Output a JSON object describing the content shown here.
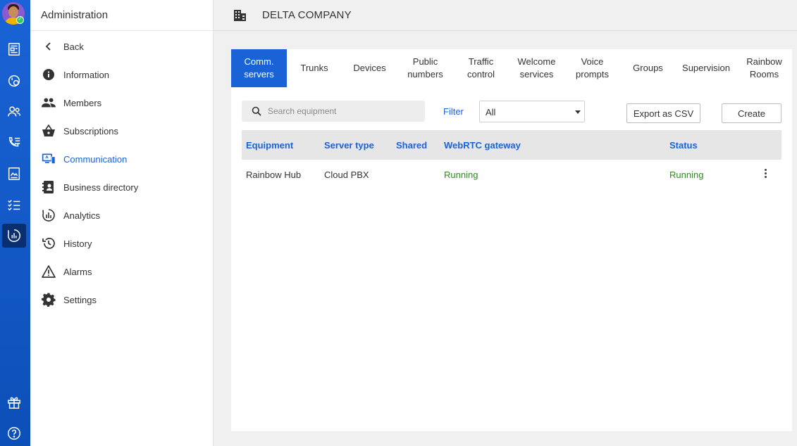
{
  "rail": {
    "items": [
      {
        "icon": "news-icon"
      },
      {
        "icon": "dial-clock-icon"
      },
      {
        "icon": "contacts-icon"
      },
      {
        "icon": "phone-list-icon"
      },
      {
        "icon": "document-icon"
      },
      {
        "icon": "checklist-icon"
      },
      {
        "icon": "dashboard-icon",
        "active": true
      },
      {
        "icon": "gift-icon"
      },
      {
        "icon": "help-icon"
      }
    ]
  },
  "panel": {
    "title": "Administration",
    "items": [
      {
        "label": "Back",
        "icon": "chevron-left-icon"
      },
      {
        "label": "Information",
        "icon": "info-icon"
      },
      {
        "label": "Members",
        "icon": "people-icon"
      },
      {
        "label": "Subscriptions",
        "icon": "basket-icon"
      },
      {
        "label": "Communication",
        "icon": "communication-icon",
        "active": true
      },
      {
        "label": "Business directory",
        "icon": "directory-icon"
      },
      {
        "label": "Analytics",
        "icon": "analytics-icon"
      },
      {
        "label": "History",
        "icon": "history-icon"
      },
      {
        "label": "Alarms",
        "icon": "warning-icon"
      },
      {
        "label": "Settings",
        "icon": "gear-icon"
      }
    ]
  },
  "topbar": {
    "company": "DELTA COMPANY",
    "icon": "building-icon"
  },
  "tabs": [
    {
      "label": "Comm.\nservers",
      "active": true
    },
    {
      "label": "Trunks"
    },
    {
      "label": "Devices"
    },
    {
      "label": "Public\nnumbers"
    },
    {
      "label": "Traffic\ncontrol"
    },
    {
      "label": "Welcome\nservices"
    },
    {
      "label": "Voice\nprompts"
    },
    {
      "label": "Groups"
    },
    {
      "label": "Supervision"
    },
    {
      "label": "Rainbow\nRooms"
    }
  ],
  "toolbar": {
    "search_placeholder": "Search equipment",
    "search_value": "",
    "filter_label": "Filter",
    "filter_value": "All",
    "export_label": "Export as CSV",
    "create_label": "Create"
  },
  "table": {
    "columns": [
      "Equipment",
      "Server type",
      "Shared",
      "WebRTC gateway",
      "Status"
    ],
    "rows": [
      {
        "equipment": "Rainbow Hub",
        "server_type": "Cloud PBX",
        "shared": "",
        "webrtc": "Running",
        "status": "Running"
      }
    ]
  },
  "colors": {
    "accent": "#1a63d6",
    "rail": "#1a63d6",
    "running": "#2e8b1f"
  }
}
